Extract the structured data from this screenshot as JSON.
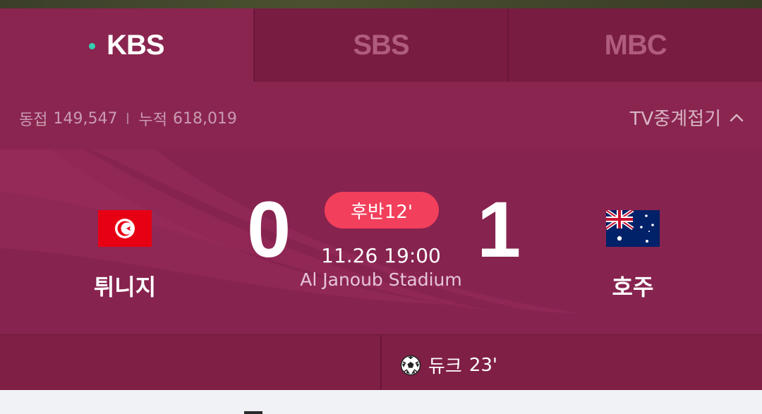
{
  "tabs": [
    {
      "label": "KBS",
      "active": true,
      "live": true
    },
    {
      "label": "SBS",
      "active": false
    },
    {
      "label": "MBC",
      "active": false
    }
  ],
  "stats": {
    "concurrent_label": "동접",
    "concurrent_value": "149,547",
    "cumulative_label": "누적",
    "cumulative_value": "618,019",
    "tv_toggle_label": "TV중계접기"
  },
  "match": {
    "home_team": "튀니지",
    "away_team": "호주",
    "home_score": "0",
    "away_score": "1",
    "status": "후반12'",
    "datetime": "11.26 19:00",
    "venue": "Al Janoub Stadium"
  },
  "scorers": {
    "home": [],
    "away": [
      {
        "player": "듀크",
        "minute": "23'",
        "icon": "soccer-ball-icon"
      }
    ]
  },
  "colors": {
    "panel": "#7a1c42",
    "active_tab": "#8a2550",
    "live_dot": "#35d0b1",
    "status_pill": "#f23f5b"
  }
}
